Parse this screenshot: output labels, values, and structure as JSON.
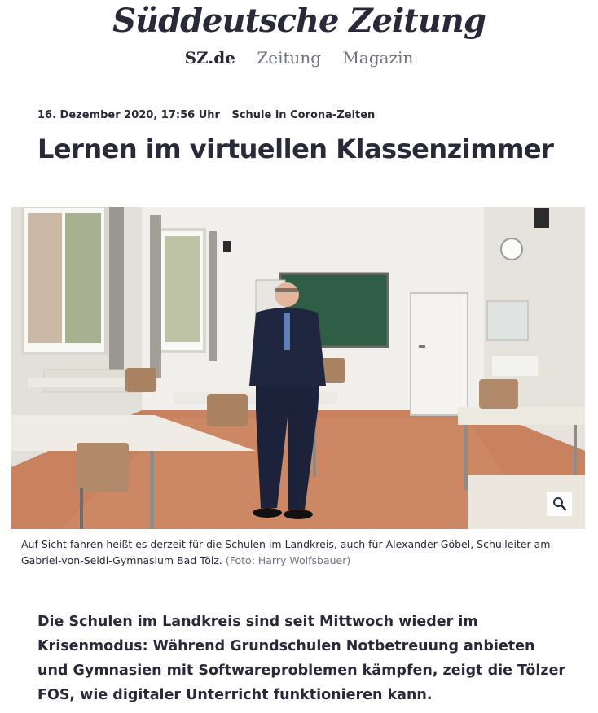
{
  "header": {
    "logo": "Süddeutsche Zeitung",
    "nav": [
      {
        "label": "SZ.de",
        "active": true
      },
      {
        "label": "Zeitung",
        "active": false
      },
      {
        "label": "Magazin",
        "active": false
      }
    ]
  },
  "article": {
    "date": "16. Dezember 2020, 17:56 Uhr",
    "topic": "Schule in Corona-Zeiten",
    "title": "Lernen im virtuellen Klassenzimmer",
    "image": {
      "zoom_icon": "magnifier-icon"
    },
    "caption": "Auf Sicht fahren heißt es derzeit für die Schulen im Landkreis, auch für Alexander Göbel, Schulleiter am Gabriel-von-Seidl-Gymnasium Bad Tölz.",
    "credit": "(Foto: Harry Wolfsbauer)",
    "lead": "Die Schulen im Landkreis sind seit Mittwoch wieder im Krisenmodus: Während Grundschulen Notbetreuung anbieten und Gymnasien mit Softwareproblemen kämpfen, zeigt die Tölzer FOS, wie digitaler Unterricht funktionieren kann."
  },
  "colors": {
    "text": "#29293a",
    "muted": "#71737f",
    "floor": "#c8825f",
    "board": "#2f5d45"
  }
}
